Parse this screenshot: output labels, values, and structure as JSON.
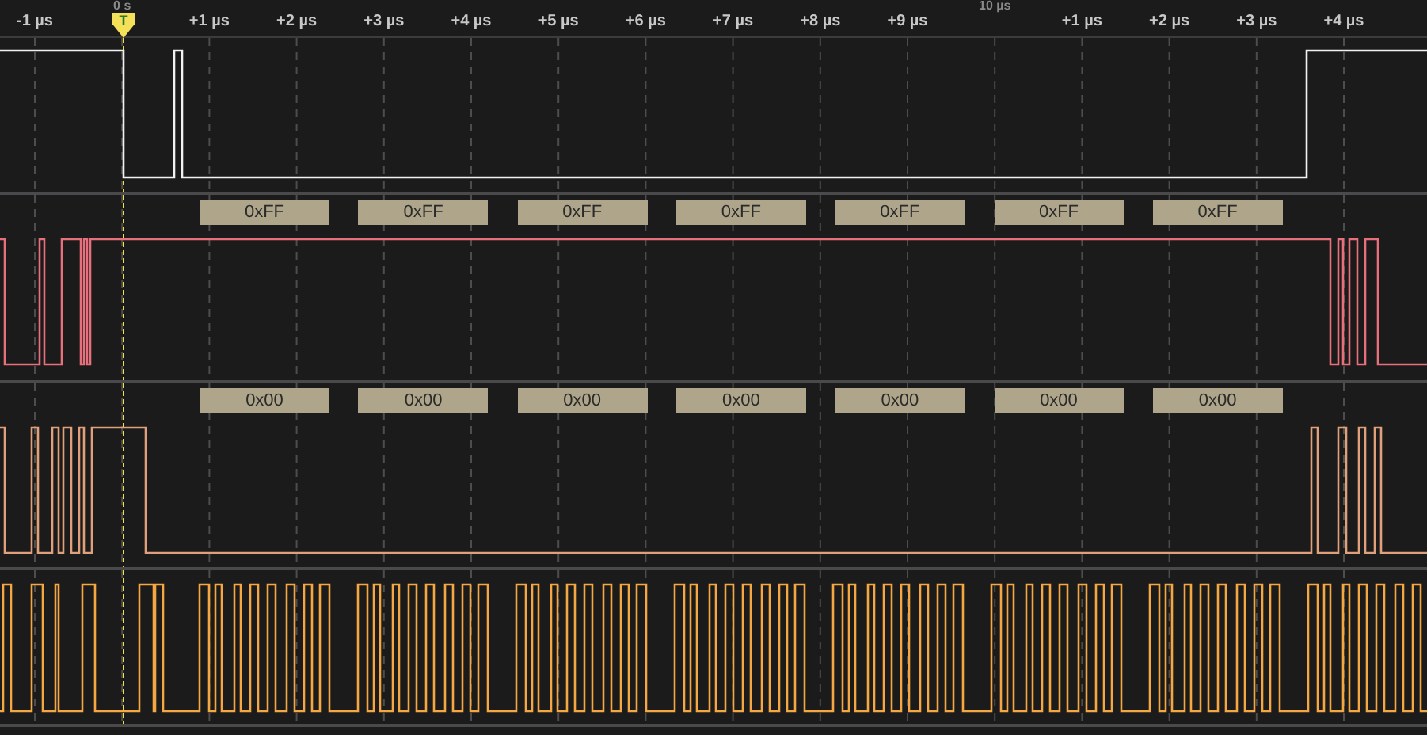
{
  "ruler": {
    "labels": [
      {
        "text": "-1 µs",
        "kind": "minor"
      },
      {
        "text": "0 s",
        "kind": "major"
      },
      {
        "text": "+1 µs",
        "kind": "minor"
      },
      {
        "text": "+2 µs",
        "kind": "minor"
      },
      {
        "text": "+3 µs",
        "kind": "minor"
      },
      {
        "text": "+4 µs",
        "kind": "minor"
      },
      {
        "text": "+5 µs",
        "kind": "minor"
      },
      {
        "text": "+6 µs",
        "kind": "minor"
      },
      {
        "text": "+7 µs",
        "kind": "minor"
      },
      {
        "text": "+8 µs",
        "kind": "minor"
      },
      {
        "text": "+9 µs",
        "kind": "minor"
      },
      {
        "text": "10 µs",
        "kind": "major"
      },
      {
        "text": "+1 µs",
        "kind": "minor"
      },
      {
        "text": "+2 µs",
        "kind": "minor"
      },
      {
        "text": "+3 µs",
        "kind": "minor"
      },
      {
        "text": "+4 µs",
        "kind": "minor"
      }
    ]
  },
  "trigger": {
    "label": "T"
  },
  "channels": [
    {
      "color": "#f2f2f2"
    },
    {
      "color": "#e8707c",
      "decodes": [
        "0xFF",
        "0xFF",
        "0xFF",
        "0xFF",
        "0xFF",
        "0xFF",
        "0xFF"
      ]
    },
    {
      "color": "#e0a07c",
      "decodes": [
        "0x00",
        "0x00",
        "0x00",
        "0x00",
        "0x00",
        "0x00",
        "0x00"
      ]
    },
    {
      "color": "#f5a742"
    }
  ]
}
